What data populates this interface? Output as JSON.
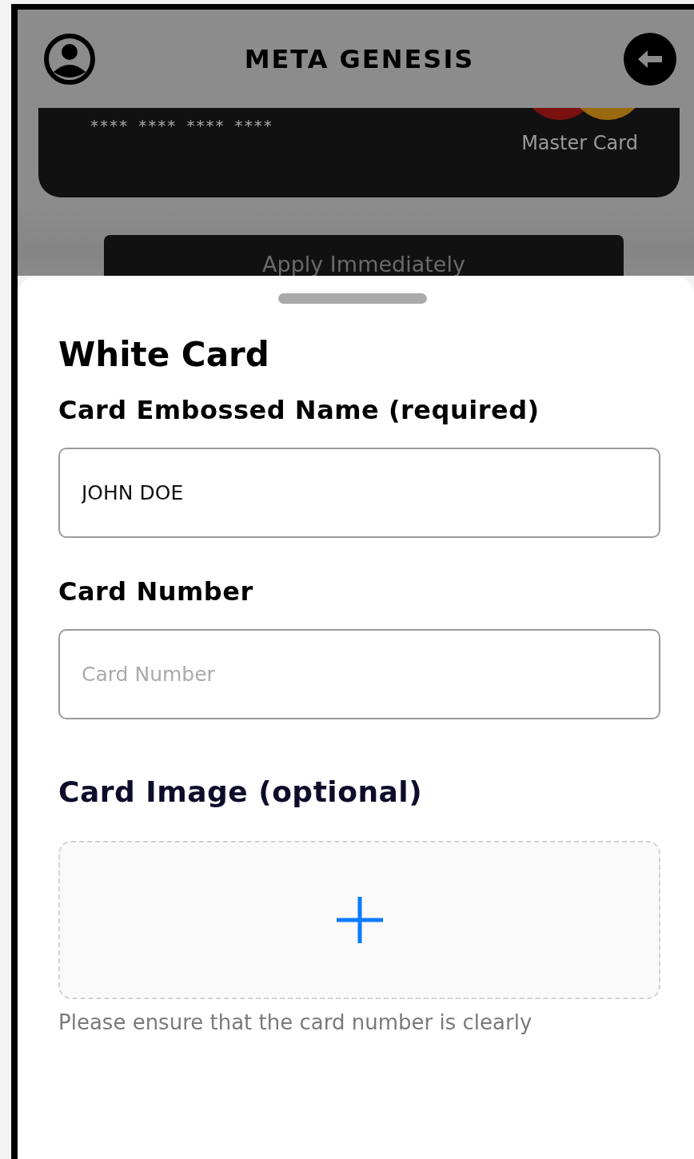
{
  "header": {
    "title": "META GENESIS"
  },
  "card": {
    "number": "**** **** **** ****",
    "brand": "Master Card"
  },
  "apply_button": {
    "label": "Apply Immediately"
  },
  "sheet": {
    "title": "White Card",
    "fields": [
      {
        "label": "Card Embossed Name (required)",
        "value": "JOHN DOE"
      },
      {
        "label": "Card Number",
        "placeholder": "Card Number"
      }
    ],
    "image_upload": {
      "label": "Card Image (optional)"
    },
    "hint": "Please ensure that the card number is clearly"
  }
}
